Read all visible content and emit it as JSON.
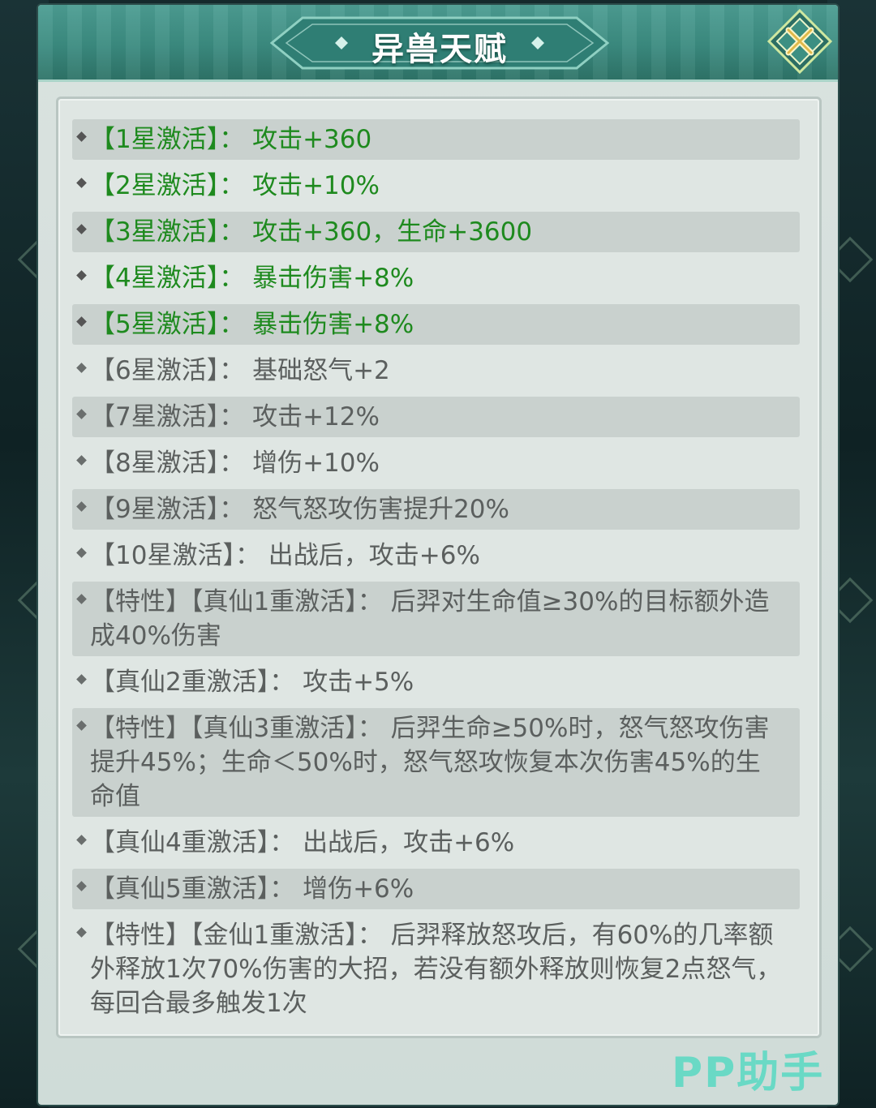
{
  "dialog": {
    "title": "异兽天赋",
    "close_icon": "close-x-icon"
  },
  "talents": [
    {
      "label": "【1星激活】： 攻击+360",
      "active": true
    },
    {
      "label": "【2星激活】： 攻击+10%",
      "active": true
    },
    {
      "label": "【3星激活】： 攻击+360，生命+3600",
      "active": true
    },
    {
      "label": "【4星激活】： 暴击伤害+8%",
      "active": true
    },
    {
      "label": "【5星激活】： 暴击伤害+8%",
      "active": true
    },
    {
      "label": "【6星激活】： 基础怒气+2",
      "active": false
    },
    {
      "label": "【7星激活】： 攻击+12%",
      "active": false
    },
    {
      "label": "【8星激活】： 增伤+10%",
      "active": false
    },
    {
      "label": "【9星激活】： 怒气怒攻伤害提升20%",
      "active": false
    },
    {
      "label": "【10星激活】： 出战后，攻击+6%",
      "active": false
    },
    {
      "label": "【特性】【真仙1重激活】： 后羿对生命值≥30%的目标额外造成40%伤害",
      "active": false
    },
    {
      "label": "【真仙2重激活】： 攻击+5%",
      "active": false
    },
    {
      "label": "【特性】【真仙3重激活】： 后羿生命≥50%时，怒气怒攻伤害提升45%；生命＜50%时，怒气怒攻恢复本次伤害45%的生命值",
      "active": false
    },
    {
      "label": "【真仙4重激活】： 出战后，攻击+6%",
      "active": false
    },
    {
      "label": "【真仙5重激活】： 增伤+6%",
      "active": false
    },
    {
      "label": "【特性】【金仙1重激活】： 后羿释放怒攻后，有60%的几率额外释放1次70%伤害的大招，若没有额外释放则恢复2点怒气，每回合最多触发1次",
      "active": false
    }
  ],
  "watermark": "PP助手",
  "colors": {
    "active_text": "#1e8a1e",
    "inactive_text": "#5b5f5e",
    "header": "#3b8b80"
  }
}
